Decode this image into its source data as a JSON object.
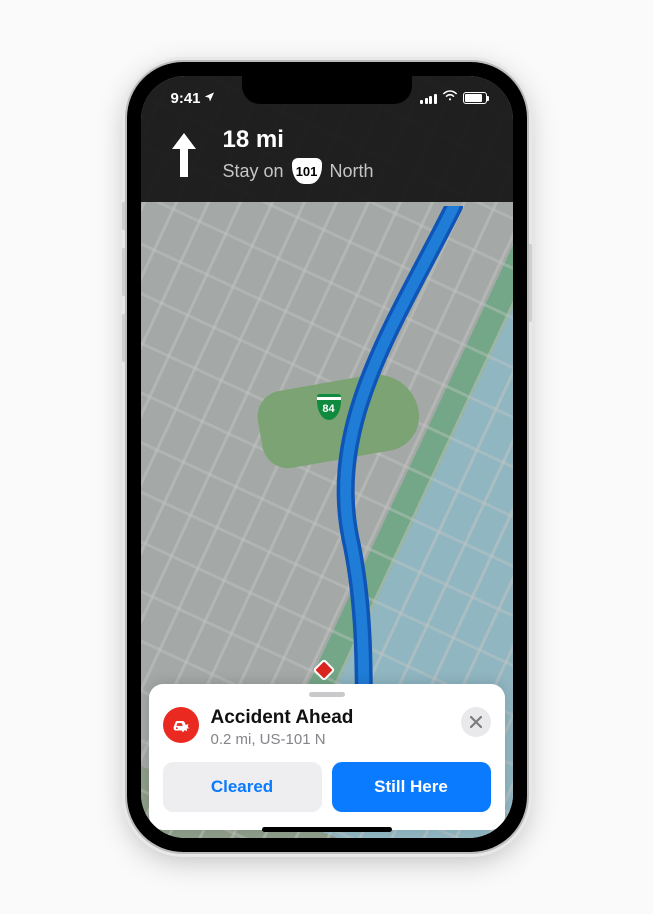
{
  "status": {
    "time": "9:41",
    "location_services": true
  },
  "navigation": {
    "distance": "18 mi",
    "instruction_prefix": "Stay on",
    "route_shield": "101",
    "instruction_suffix": "North"
  },
  "map": {
    "interchange_shield": "84"
  },
  "incident_card": {
    "title": "Accident Ahead",
    "subtitle": "0.2 mi, US-101 N",
    "cleared_label": "Cleared",
    "still_here_label": "Still Here"
  },
  "colors": {
    "route": "#0a7aff",
    "accent": "#0a7aff",
    "danger": "#ea2a20"
  }
}
